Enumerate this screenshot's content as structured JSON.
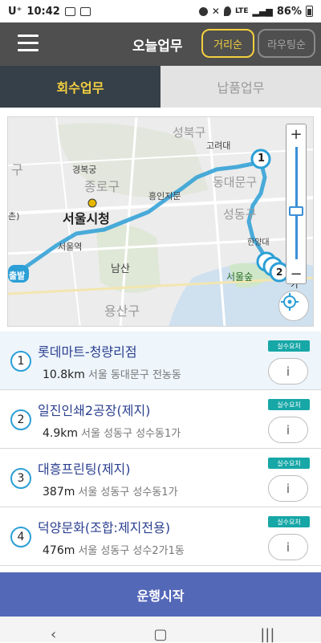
{
  "status_bar": {
    "carrier": "U⁺",
    "time": "10:42",
    "network": "LTE",
    "battery": "86%"
  },
  "header": {
    "title": "오늘업무",
    "distance_button": "거리순",
    "routing_button": "라우팅순",
    "accent": "#f4d03f"
  },
  "tabs": [
    {
      "label": "회수업무",
      "active": true
    },
    {
      "label": "납품업무",
      "active": false
    }
  ],
  "map": {
    "labels": {
      "seongbuk": "성북구",
      "goryeodae": "고려대",
      "gyeongbokgung": "경복궁",
      "jongno": "종로구",
      "heunginjimun": "흥인지문",
      "seoul_city_hall": "서울시청",
      "seoul_station": "서울역",
      "namsan": "남산",
      "seoul_forest": "서울숲",
      "yongsan": "용산구",
      "departure": "출발",
      "dongdaemun": "동대문구",
      "seongdong": "성동구",
      "hanyang": "한양대",
      "eunpyeong": "구",
      "edge_left": "촌)"
    },
    "route_color": "#2b9fd6",
    "markers": [
      "1",
      "2",
      "3",
      "4"
    ],
    "marker_extra": "가"
  },
  "items": [
    {
      "num": "1",
      "name": "롯데마트-청량리점",
      "distance": "10.8km",
      "address": "서울 동대문구 전농동",
      "badge": "실수요처",
      "info": "i",
      "selected": true
    },
    {
      "num": "2",
      "name": "일진인쇄2공장(제지)",
      "distance": "4.9km",
      "address": "서울 성동구 성수동1가",
      "badge": "실수요처",
      "info": "i",
      "selected": false
    },
    {
      "num": "3",
      "name": "대흥프린팅(제지)",
      "distance": "387m",
      "address": "서울 성동구 성수동1가",
      "badge": "실수요처",
      "info": "i",
      "selected": false
    },
    {
      "num": "4",
      "name": "덕양문화(조합:제지전용)",
      "distance": "476m",
      "address": "서울 성동구 성수2가1동",
      "badge": "실수요처",
      "info": "i",
      "selected": false
    }
  ],
  "start_button": "운행시작",
  "zoom": {
    "plus": "+",
    "minus": "−"
  }
}
